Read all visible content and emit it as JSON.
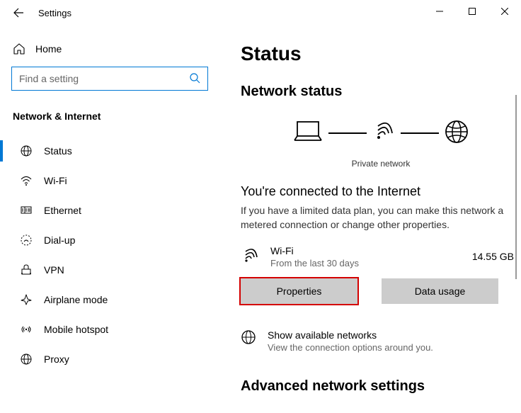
{
  "window": {
    "title": "Settings"
  },
  "sidebar": {
    "home": "Home",
    "search_placeholder": "Find a setting",
    "category": "Network & Internet",
    "items": [
      {
        "label": "Status"
      },
      {
        "label": "Wi-Fi"
      },
      {
        "label": "Ethernet"
      },
      {
        "label": "Dial-up"
      },
      {
        "label": "VPN"
      },
      {
        "label": "Airplane mode"
      },
      {
        "label": "Mobile hotspot"
      },
      {
        "label": "Proxy"
      }
    ]
  },
  "main": {
    "page_title": "Status",
    "status_heading": "Network status",
    "diagram_label": "Private network",
    "connected_title": "You're connected to the Internet",
    "connected_desc": "If you have a limited data plan, you can make this network a metered connection or change other properties.",
    "conn_name": "Wi-Fi",
    "conn_sub": "From the last 30 days",
    "conn_usage": "14.55 GB",
    "btn_properties": "Properties",
    "btn_data_usage": "Data usage",
    "available_title": "Show available networks",
    "available_sub": "View the connection options around you.",
    "advanced_heading": "Advanced network settings"
  }
}
